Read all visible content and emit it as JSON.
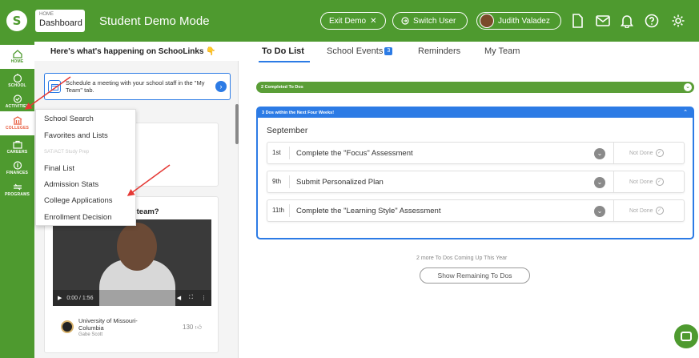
{
  "header": {
    "logo_glyph": "S",
    "dashboard_small": "HOME",
    "dashboard_label": "Dashboard",
    "mode_title": "Student Demo Mode",
    "exit_demo": "Exit Demo",
    "exit_glyph": "✕",
    "switch_user": "Switch User",
    "user_name": "Judith Valadez",
    "icons": [
      "file-icon",
      "mail-icon",
      "bell-icon",
      "help-icon",
      "gear-icon"
    ]
  },
  "sidebar": {
    "items": [
      {
        "label": "HOME",
        "icon": "home-icon"
      },
      {
        "label": "SCHOOL",
        "icon": "school-icon"
      },
      {
        "label": "ACTIVITIES",
        "icon": "activities-icon"
      },
      {
        "label": "COLLEGES",
        "icon": "colleges-icon"
      },
      {
        "label": "CAREERS",
        "icon": "careers-icon"
      },
      {
        "label": "FINANCES",
        "icon": "finances-icon"
      },
      {
        "label": "PROGRAMS",
        "icon": "programs-icon"
      }
    ]
  },
  "feed": {
    "heading": "Here's what's happening on SchooLinks 👇",
    "meeting_card": "Schedule a meeting with your school staff in the \"My Team\" tab.",
    "card1_fragment": "s",
    "card2_title_fragment": "er team?",
    "video_time": "0:00 / 1:56",
    "university_name": "University of Missouri-Columbia",
    "university_person": "Gabe Scott",
    "likes": "130"
  },
  "dropdown": {
    "items": [
      "School Search",
      "Favorites and Lists",
      "SAT/ACT Study Prep",
      "Final List",
      "Admission Stats",
      "College Applications",
      "Enrollment Decision"
    ]
  },
  "main": {
    "tabs": [
      {
        "label": "To Do List"
      },
      {
        "label": "School Events",
        "badge": "3"
      },
      {
        "label": "Reminders"
      },
      {
        "label": "My Team"
      }
    ],
    "completed_bar": "2 Completed To Dos",
    "due_panel_title": "3 Dos within the Next Four Weeks!",
    "month": "September",
    "todos": [
      {
        "date": "1st",
        "title": "Complete the \"Focus\" Assessment",
        "status": "Not Done"
      },
      {
        "date": "9th",
        "title": "Submit Personalized Plan",
        "status": "Not Done"
      },
      {
        "date": "11th",
        "title": "Complete the \"Learning Style\" Assessment",
        "status": "Not Done"
      }
    ],
    "more_text": "2 more To Dos Coming Up This Year",
    "show_button": "Show Remaining To Dos"
  },
  "colors": {
    "brand_green": "#4e9a2f",
    "accent_blue": "#2c7be5",
    "annotation_red": "#e53935"
  }
}
